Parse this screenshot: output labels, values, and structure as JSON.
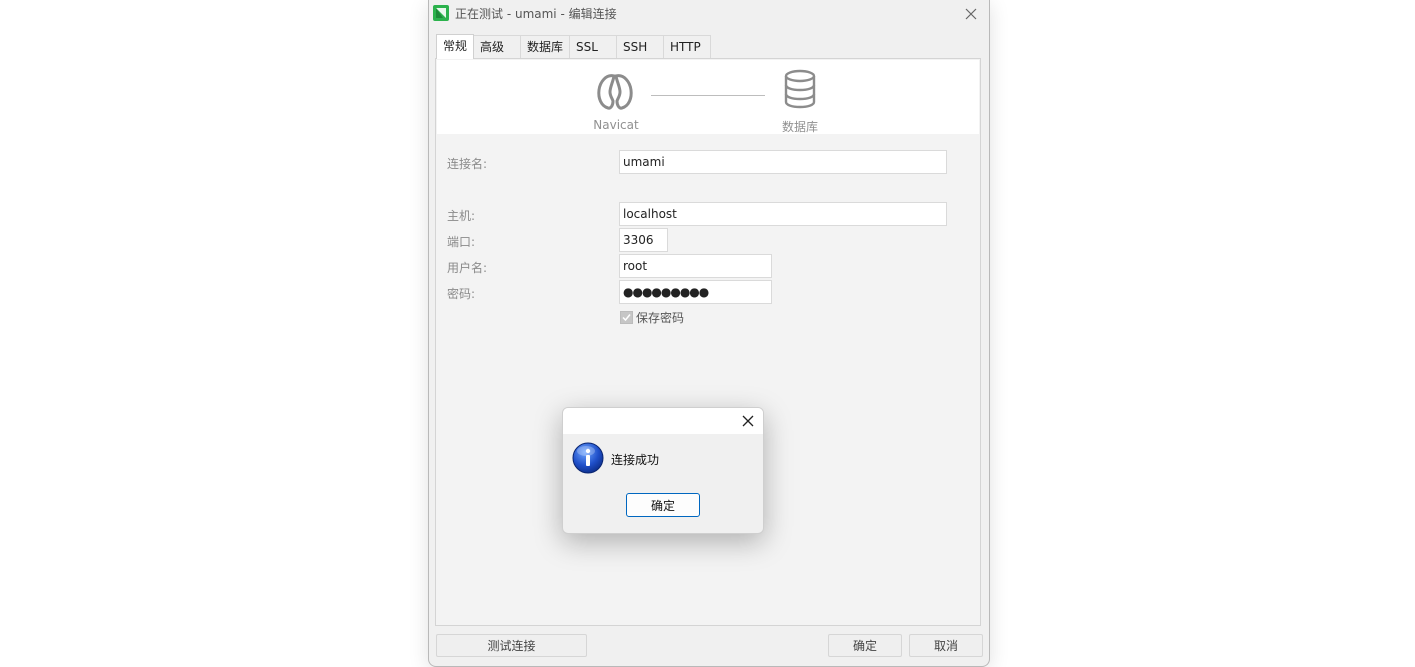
{
  "window": {
    "title": "正在测试 - umami - 编辑连接"
  },
  "tabs": [
    {
      "label": "常规",
      "active": true
    },
    {
      "label": "高级",
      "active": false
    },
    {
      "label": "数据库",
      "active": false
    },
    {
      "label": "SSL",
      "active": false
    },
    {
      "label": "SSH",
      "active": false
    },
    {
      "label": "HTTP",
      "active": false
    }
  ],
  "banner": {
    "left_label": "Navicat",
    "right_label": "数据库"
  },
  "form": {
    "connection_name_label": "连接名:",
    "connection_name_value": "umami",
    "host_label": "主机:",
    "host_value": "localhost",
    "port_label": "端口:",
    "port_value": "3306",
    "username_label": "用户名:",
    "username_value": "root",
    "password_label": "密码:",
    "password_value": "●●●●●●●●●",
    "save_password_label": "保存密码",
    "save_password_checked": true
  },
  "footer": {
    "test_connection": "测试连接",
    "ok": "确定",
    "cancel": "取消"
  },
  "dialog": {
    "message": "连接成功",
    "ok": "确定",
    "icon": "info-icon"
  },
  "colors": {
    "accent": "#0067c0",
    "navicat_green": "#2bb24c"
  }
}
